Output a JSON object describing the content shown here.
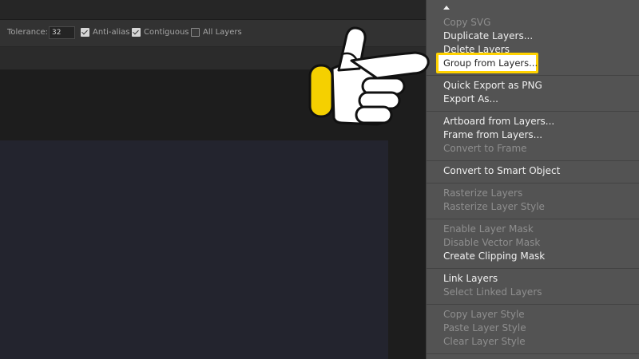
{
  "options_bar": {
    "tolerance_label": "Tolerance:",
    "tolerance_value": "32",
    "anti_alias_label": "Anti-alias",
    "contiguous_label": "Contiguous",
    "all_layers_label": "All Layers"
  },
  "context_menu": {
    "highlighted_index": 3,
    "items": [
      {
        "label": "Copy SVG",
        "enabled": false
      },
      {
        "label": "Duplicate Layers...",
        "enabled": true
      },
      {
        "label": "Delete Layers",
        "enabled": true
      },
      {
        "label": "Group from Layers...",
        "enabled": true
      },
      {
        "label": "Quick Export as PNG",
        "enabled": true
      },
      {
        "label": "Export As...",
        "enabled": true
      },
      {
        "label": "Artboard from Layers...",
        "enabled": true
      },
      {
        "label": "Frame from Layers...",
        "enabled": true
      },
      {
        "label": "Convert to Frame",
        "enabled": false
      },
      {
        "label": "Convert to Smart Object",
        "enabled": true
      },
      {
        "label": "Rasterize Layers",
        "enabled": false
      },
      {
        "label": "Rasterize Layer Style",
        "enabled": false
      },
      {
        "label": "Enable Layer Mask",
        "enabled": false
      },
      {
        "label": "Disable Vector Mask",
        "enabled": false
      },
      {
        "label": "Create Clipping Mask",
        "enabled": true
      },
      {
        "label": "Link Layers",
        "enabled": true
      },
      {
        "label": "Select Linked Layers",
        "enabled": false
      },
      {
        "label": "Copy Layer Style",
        "enabled": false
      },
      {
        "label": "Paste Layer Style",
        "enabled": false
      },
      {
        "label": "Clear Layer Style",
        "enabled": false
      }
    ]
  },
  "colors": {
    "highlight_border": "#ffd200",
    "menu_background": "#535353",
    "enabled_text": "#f0f0f0",
    "disabled_text": "#8e8e8e"
  },
  "pointer": {
    "icon": "pointing-hand-icon"
  }
}
